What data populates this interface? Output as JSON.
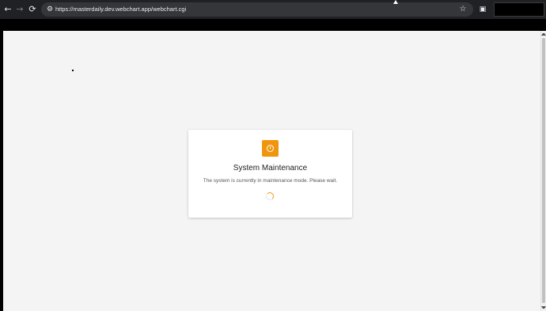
{
  "browser": {
    "url": "https://masterdaily.dev.webchart.app/webchart.cgi",
    "icons": {
      "back": "arrow-left-icon",
      "forward": "arrow-right-icon",
      "reload": "reload-icon",
      "site_info": "site-info-icon",
      "bookmark": "star-icon",
      "extension": "cast-icon"
    }
  },
  "dialog": {
    "title": "System Maintenance",
    "message": "The system is currently in maintenance mode. Please wait.",
    "icon": "maintenance-icon",
    "accent_color": "#f0960e"
  }
}
